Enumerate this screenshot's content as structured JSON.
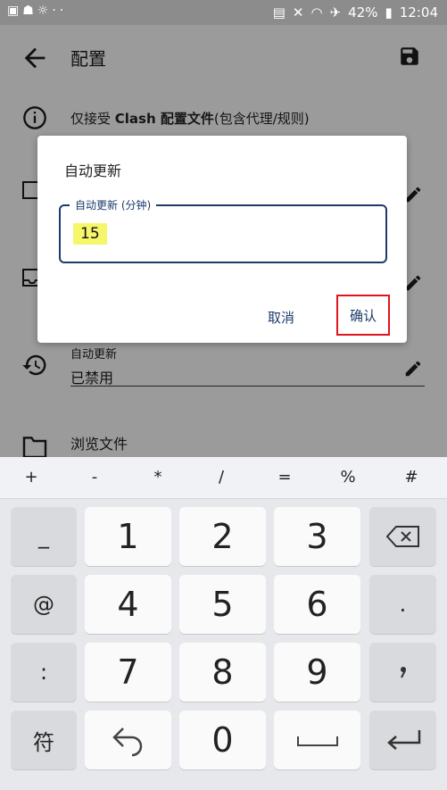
{
  "status_bar": {
    "left_icons": [
      "image-icon",
      "android-icon",
      "weather-icon",
      "dots-icon"
    ],
    "battery_percent": "42%",
    "time": "12:04"
  },
  "app_bar": {
    "title": "配置"
  },
  "settings": {
    "info_text_prefix": "仅接受 ",
    "info_text_bold": "Clash 配置文件",
    "info_text_suffix": "(包含代理/规则)",
    "auto_update_title": "自动更新",
    "auto_update_value": "已禁用",
    "browse_files_label": "浏览文件"
  },
  "dialog": {
    "title": "自动更新",
    "field_label": "自动更新 (分钟)",
    "field_value": "15",
    "cancel_label": "取消",
    "confirm_label": "确认"
  },
  "keyboard": {
    "symbols": [
      "+",
      "-",
      "*",
      "/",
      "=",
      "%",
      "#"
    ],
    "row1": [
      "_",
      "1",
      "2",
      "3"
    ],
    "row2": [
      "@",
      "4",
      "5",
      "6",
      "."
    ],
    "row3": [
      ":",
      "7",
      "8",
      "9"
    ],
    "row4_left": "符",
    "zero": "0"
  },
  "colors": {
    "accent": "#1c3b6a",
    "highlight": "#f6f66b",
    "red_box": "#e2141b"
  }
}
